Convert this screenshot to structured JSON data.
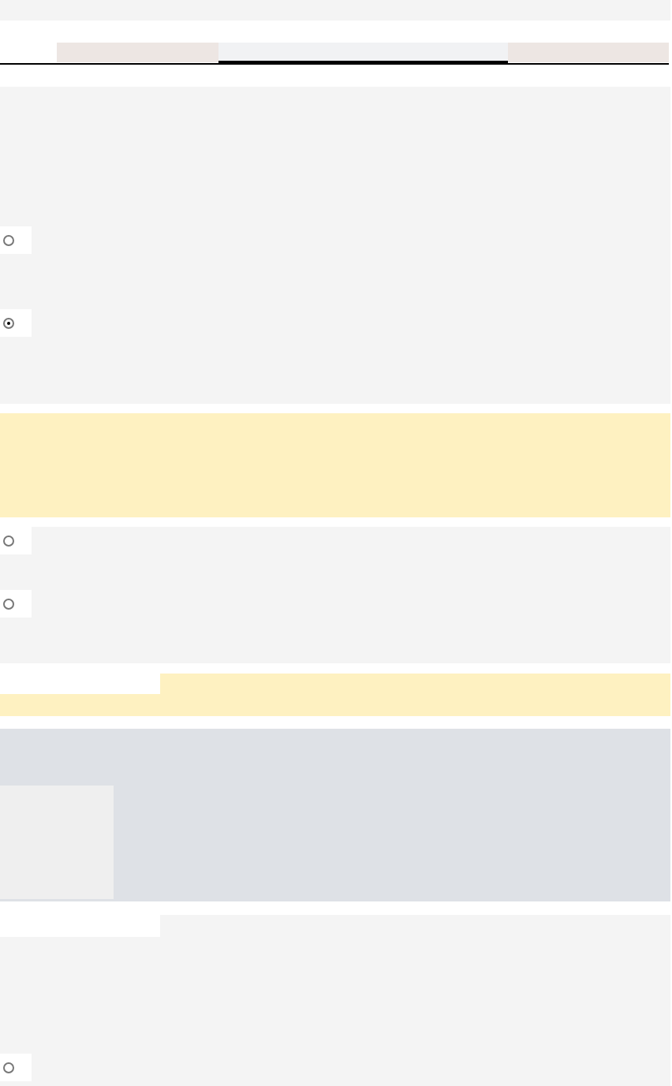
{
  "tabs": [
    {
      "selected": false
    },
    {
      "selected": true
    },
    {
      "selected": false
    }
  ],
  "panels": [
    {
      "kind": "plain",
      "radios": [
        {
          "selected": false
        },
        {
          "selected": true
        }
      ]
    },
    {
      "kind": "notice"
    },
    {
      "kind": "list",
      "radios": [
        {
          "selected": false
        },
        {
          "selected": false
        }
      ]
    },
    {
      "kind": "notice-tab"
    },
    {
      "kind": "media"
    },
    {
      "kind": "plain-tab",
      "radios": [
        {
          "selected": false
        }
      ]
    }
  ]
}
